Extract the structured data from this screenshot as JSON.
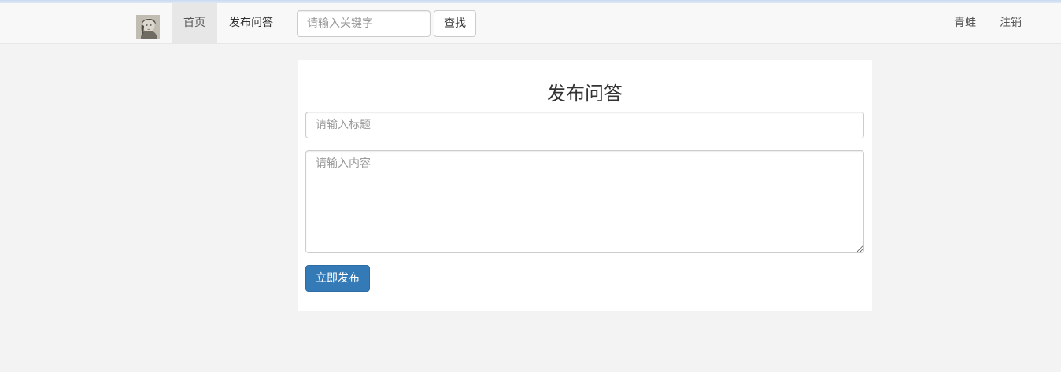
{
  "navbar": {
    "home_label": "首页",
    "publish_label": "发布问答",
    "search": {
      "placeholder": "请输入关键字",
      "value": ""
    },
    "search_button_label": "查找",
    "username": "青蛙",
    "logout_label": "注销"
  },
  "form": {
    "heading": "发布问答",
    "title_placeholder": "请输入标题",
    "content_placeholder": "请输入内容",
    "submit_label": "立即发布"
  },
  "colors": {
    "primary": "#337ab7",
    "page_background": "#f3f3f3",
    "navbar_background": "#f8f8f8",
    "active_nav_background": "#e7e7e7"
  },
  "icons": {
    "brand": "avatar-logo"
  }
}
